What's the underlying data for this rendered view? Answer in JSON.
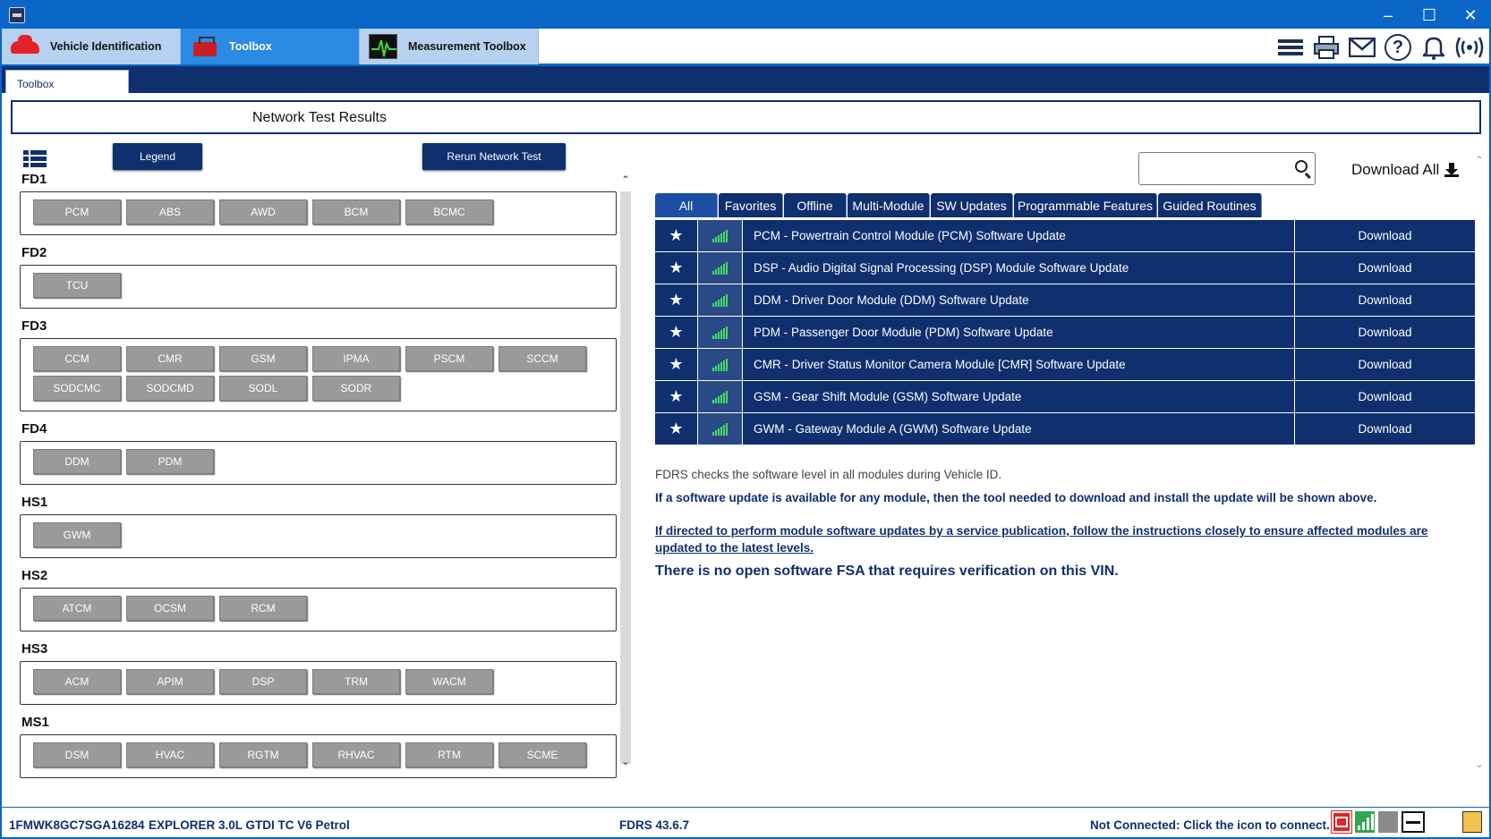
{
  "app": {
    "tabs": [
      {
        "label": "Vehicle Identification"
      },
      {
        "label": "Toolbox"
      },
      {
        "label": "Measurement Toolbox"
      }
    ]
  },
  "subtab": {
    "label": "Toolbox"
  },
  "page": {
    "title": "Network Test Results"
  },
  "buttons": {
    "legend": "Legend",
    "rerun": "Rerun Network Test"
  },
  "search": {
    "value": ""
  },
  "download_all": "Download All",
  "networks": [
    {
      "name": "FD1",
      "modules": [
        "PCM",
        "ABS",
        "AWD",
        "BCM",
        "BCMC"
      ]
    },
    {
      "name": "FD2",
      "modules": [
        "TCU"
      ]
    },
    {
      "name": "FD3",
      "modules": [
        "CCM",
        "CMR",
        "GSM",
        "IPMA",
        "PSCM",
        "SCCM",
        "SODCMC",
        "SODCMD",
        "SODL",
        "SODR"
      ]
    },
    {
      "name": "FD4",
      "modules": [
        "DDM",
        "PDM"
      ]
    },
    {
      "name": "HS1",
      "modules": [
        "GWM"
      ]
    },
    {
      "name": "HS2",
      "modules": [
        "ATCM",
        "OCSM",
        "RCM"
      ]
    },
    {
      "name": "HS3",
      "modules": [
        "ACM",
        "APIM",
        "DSP",
        "TRM",
        "WACM"
      ]
    },
    {
      "name": "MS1",
      "modules": [
        "DSM",
        "HVAC",
        "RGTM",
        "RHVAC",
        "RTM",
        "SCME"
      ]
    }
  ],
  "filters": [
    "All",
    "Favorites",
    "Offline",
    "Multi-Module",
    "SW Updates",
    "Programmable Features",
    "Guided Routines"
  ],
  "updates": [
    {
      "desc": "PCM - Powertrain Control Module (PCM) Software Update",
      "action": "Download"
    },
    {
      "desc": "DSP - Audio Digital Signal Processing (DSP) Module Software Update",
      "action": "Download"
    },
    {
      "desc": "DDM - Driver Door Module (DDM) Software Update",
      "action": "Download"
    },
    {
      "desc": "PDM - Passenger Door Module (PDM) Software Update",
      "action": "Download"
    },
    {
      "desc": "CMR - Driver Status Monitor Camera Module [CMR] Software Update",
      "action": "Download"
    },
    {
      "desc": "GSM - Gear Shift Module (GSM) Software Update",
      "action": "Download"
    },
    {
      "desc": "GWM - Gateway Module A (GWM) Software Update",
      "action": "Download"
    }
  ],
  "info": {
    "line1": "FDRS checks the software level in all modules during Vehicle ID.",
    "line2": "If a software update is available for any module, then the tool needed to download and install the update will be shown above.",
    "line3": "If directed to perform module software updates by a service publication, follow the instructions closely to ensure affected modules are updated to the latest levels.",
    "line4": "There is no open software FSA that requires verification on this VIN."
  },
  "status": {
    "vin": "1FMWK8GC7SGA16284",
    "vehicle": "EXPLORER 3.0L GTDI TC V6 Petrol",
    "version": "FDRS 43.6.7",
    "connection": "Not Connected: Click the icon to connect."
  },
  "icons": {
    "favorite": "star-icon",
    "signal": "signal-icon"
  },
  "colors": {
    "navy": "#0f2f6e",
    "titlebar": "#0a66c7",
    "module_gray": "#9a9a9a"
  }
}
